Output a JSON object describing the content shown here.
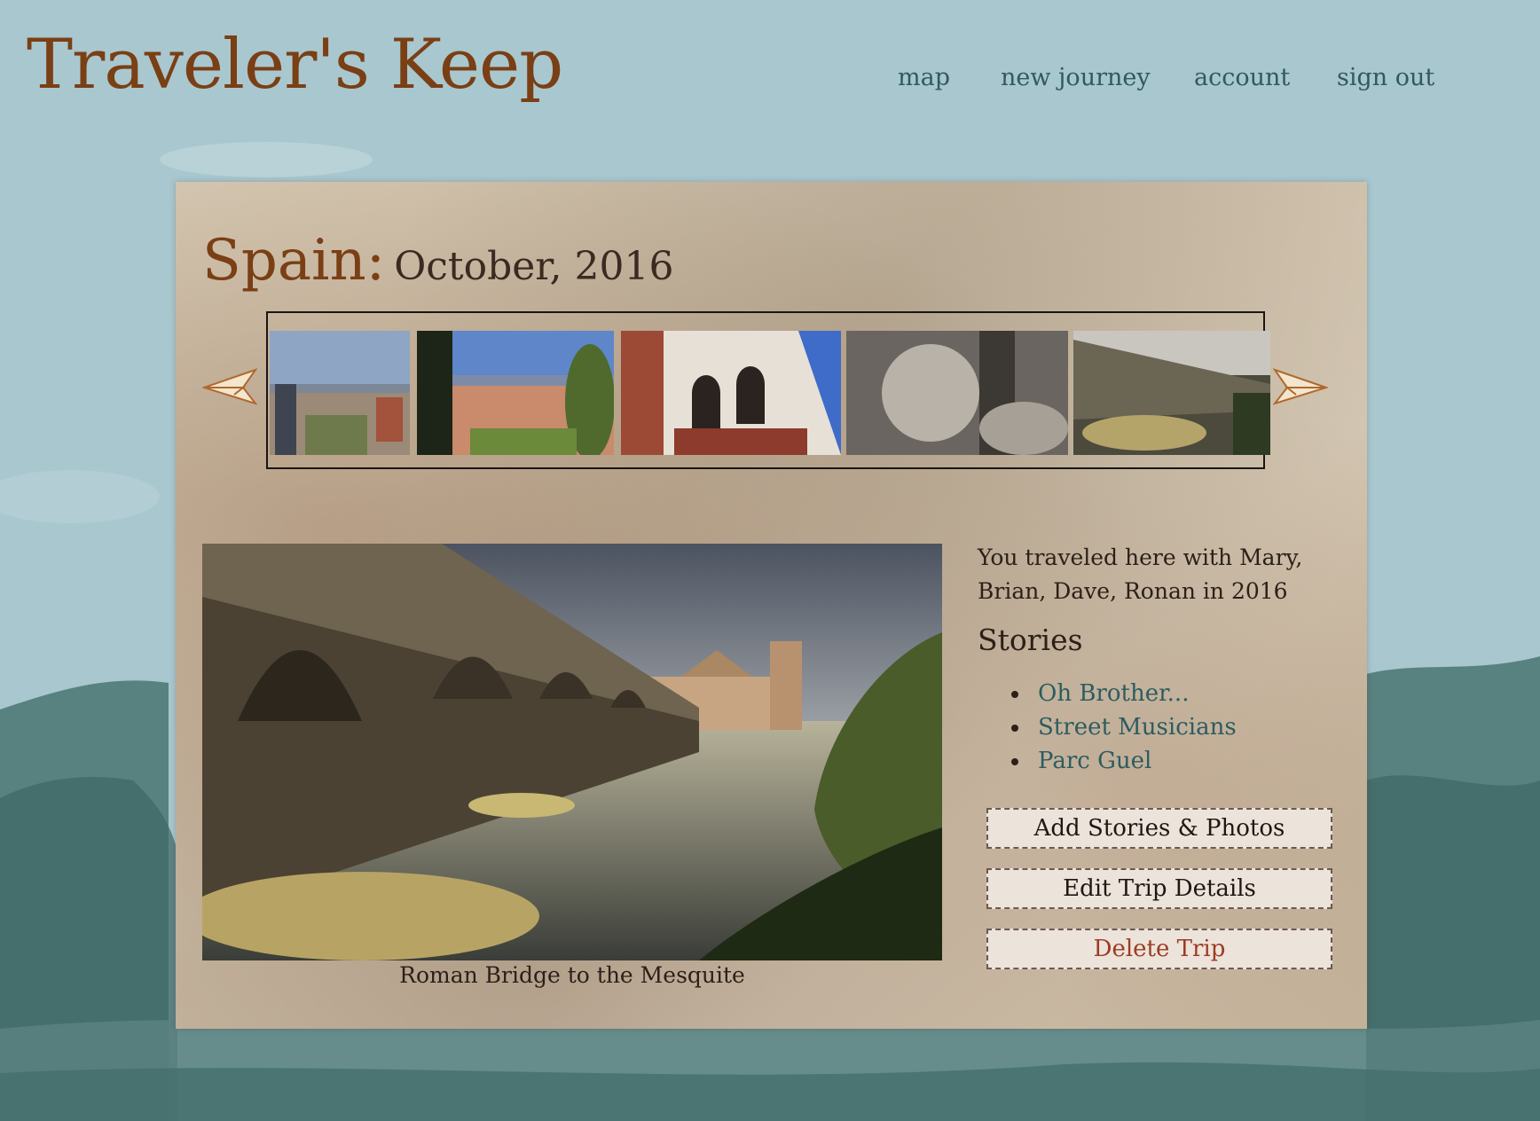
{
  "header": {
    "logo": "Traveler's Keep",
    "nav": [
      "map",
      "new journey",
      "account",
      "sign out"
    ]
  },
  "trip": {
    "country": "Spain:",
    "date": "October, 2016",
    "companions_text": "You traveled here with Mary, Brian, Dave, Ronan in 2016",
    "stories_heading": "Stories",
    "stories": [
      "Oh Brother...",
      "Street Musicians",
      "Parc Guel"
    ],
    "featured_caption": "Roman Bridge to the Mesquite",
    "thumbnails": [
      "city-view-photo",
      "hillside-town-photo",
      "arched-building-photo",
      "stone-sculpture-photo",
      "roman-bridge-photo"
    ]
  },
  "actions": {
    "add": "Add Stories & Photos",
    "edit": "Edit Trip Details",
    "delete": "Delete Trip"
  },
  "colors": {
    "sky": "#a9c7cf",
    "logo": "#7a3f14",
    "nav": "#2f5b5e",
    "link": "#2d5c60",
    "delete": "#9c3c22",
    "button_bg": "#ece3db"
  },
  "icons": {
    "prev": "paper-plane-left-icon",
    "next": "paper-plane-right-icon"
  }
}
